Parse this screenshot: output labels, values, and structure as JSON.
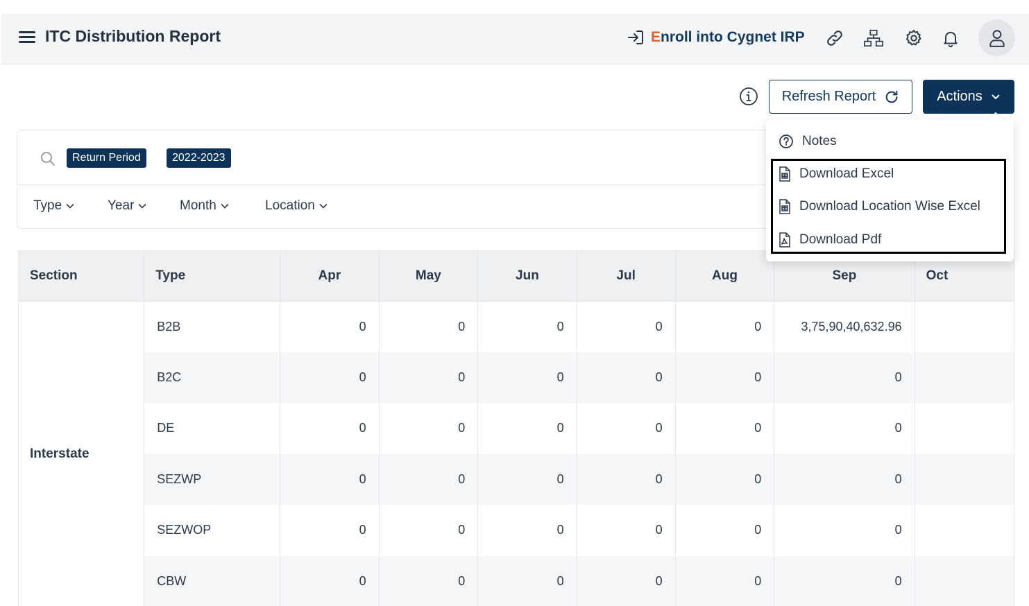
{
  "header": {
    "title": "ITC Distribution Report",
    "enroll_first": "E",
    "enroll_rest": "nroll into Cygnet IRP"
  },
  "toolbar": {
    "refresh_label": "Refresh Report",
    "actions_label": "Actions"
  },
  "filters": {
    "chips": [
      "Return Period",
      "2022-2023"
    ],
    "dropdowns": [
      "Type",
      "Year",
      "Month",
      "Location"
    ]
  },
  "menu": {
    "items": [
      "Notes",
      "Download Excel",
      "Download Location Wise Excel",
      "Download Pdf"
    ]
  },
  "table": {
    "headers": [
      "Section",
      "Type",
      "Apr",
      "May",
      "Jun",
      "Jul",
      "Aug",
      "Sep",
      "Oct"
    ],
    "section": "Interstate",
    "rows": [
      {
        "type": "B2B",
        "values": [
          "0",
          "0",
          "0",
          "0",
          "0",
          "3,75,90,40,632.96",
          ""
        ]
      },
      {
        "type": "B2C",
        "values": [
          "0",
          "0",
          "0",
          "0",
          "0",
          "0",
          ""
        ]
      },
      {
        "type": "DE",
        "values": [
          "0",
          "0",
          "0",
          "0",
          "0",
          "0",
          ""
        ]
      },
      {
        "type": "SEZWP",
        "values": [
          "0",
          "0",
          "0",
          "0",
          "0",
          "0",
          ""
        ]
      },
      {
        "type": "SEZWOP",
        "values": [
          "0",
          "0",
          "0",
          "0",
          "0",
          "0",
          ""
        ]
      },
      {
        "type": "CBW",
        "values": [
          "0",
          "0",
          "0",
          "0",
          "0",
          "0",
          ""
        ]
      }
    ]
  },
  "colors": {
    "primary": "#0d3358",
    "accent": "#e0622a",
    "header_bg": "#f4f5f7"
  }
}
